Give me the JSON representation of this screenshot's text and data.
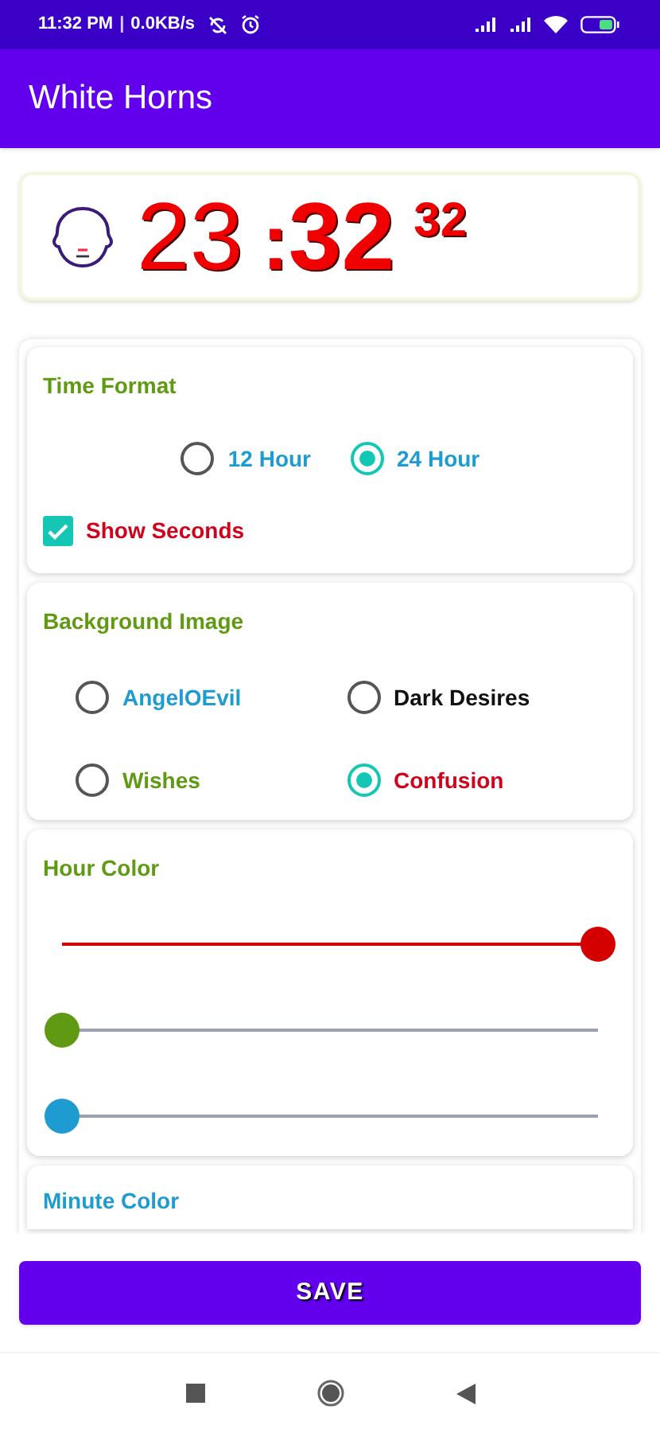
{
  "status_bar": {
    "time": "11:32 PM",
    "divider": "|",
    "network_speed": "0.0KB/s"
  },
  "app_bar": {
    "title": "White Horns"
  },
  "clock": {
    "hours": "23",
    "separator": ":",
    "minutes": "32",
    "seconds": "32"
  },
  "time_format": {
    "title": "Time Format",
    "options": [
      {
        "label": "12 Hour",
        "selected": false
      },
      {
        "label": "24 Hour",
        "selected": true
      }
    ],
    "show_seconds": {
      "label": "Show Seconds",
      "checked": true
    }
  },
  "background_image": {
    "title": "Background Image",
    "options": [
      {
        "label": "AngelOEvil",
        "selected": false,
        "color": "#1e9bd0"
      },
      {
        "label": "Dark Desires",
        "selected": false,
        "color": "#111111"
      },
      {
        "label": "Wishes",
        "selected": false,
        "color": "#5f9a12"
      },
      {
        "label": "Confusion",
        "selected": true,
        "color": "#d0021b"
      }
    ]
  },
  "hour_color": {
    "title": "Hour Color",
    "sliders": [
      {
        "color": "#d40000",
        "level": 1
      },
      {
        "color": "#5f9a12",
        "level": 0
      },
      {
        "color": "#1e9bd0",
        "level": 0
      }
    ]
  },
  "minute_color": {
    "title": "Minute Color"
  },
  "save_button": {
    "label": "SAVE"
  }
}
